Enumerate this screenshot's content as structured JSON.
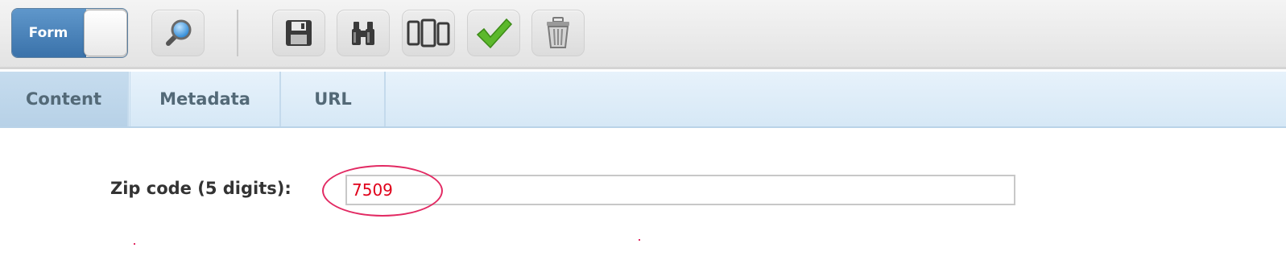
{
  "toolbar": {
    "mode_toggle_label": "Form",
    "buttons": [
      {
        "name": "preview",
        "icon": "magnifier-icon"
      },
      {
        "name": "save",
        "icon": "floppy-disk-icon"
      },
      {
        "name": "find",
        "icon": "binoculars-icon"
      },
      {
        "name": "devices",
        "icon": "devices-icon"
      },
      {
        "name": "approve",
        "icon": "checkmark-icon"
      },
      {
        "name": "delete",
        "icon": "trash-icon"
      }
    ]
  },
  "tabs": [
    {
      "label": "Content",
      "active": true
    },
    {
      "label": "Metadata",
      "active": false
    },
    {
      "label": "URL",
      "active": false
    }
  ],
  "form": {
    "zip_label": "Zip code (5 digits):",
    "zip_value": "7509"
  },
  "colors": {
    "accent": "#3a72aa",
    "error_text": "#e0001a",
    "annotation": "#e22a63",
    "tab_bg": "#d6e8f6",
    "tab_text": "#536977"
  }
}
